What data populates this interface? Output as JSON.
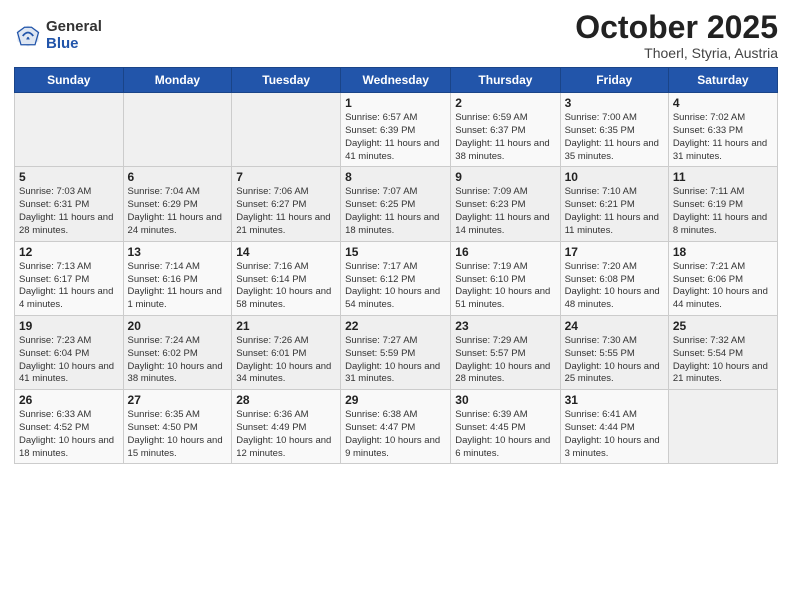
{
  "logo": {
    "general": "General",
    "blue": "Blue"
  },
  "title": {
    "month": "October 2025",
    "location": "Thoerl, Styria, Austria"
  },
  "days_of_week": [
    "Sunday",
    "Monday",
    "Tuesday",
    "Wednesday",
    "Thursday",
    "Friday",
    "Saturday"
  ],
  "weeks": [
    [
      {
        "day": "",
        "info": ""
      },
      {
        "day": "",
        "info": ""
      },
      {
        "day": "",
        "info": ""
      },
      {
        "day": "1",
        "info": "Sunrise: 6:57 AM\nSunset: 6:39 PM\nDaylight: 11 hours and 41 minutes."
      },
      {
        "day": "2",
        "info": "Sunrise: 6:59 AM\nSunset: 6:37 PM\nDaylight: 11 hours and 38 minutes."
      },
      {
        "day": "3",
        "info": "Sunrise: 7:00 AM\nSunset: 6:35 PM\nDaylight: 11 hours and 35 minutes."
      },
      {
        "day": "4",
        "info": "Sunrise: 7:02 AM\nSunset: 6:33 PM\nDaylight: 11 hours and 31 minutes."
      }
    ],
    [
      {
        "day": "5",
        "info": "Sunrise: 7:03 AM\nSunset: 6:31 PM\nDaylight: 11 hours and 28 minutes."
      },
      {
        "day": "6",
        "info": "Sunrise: 7:04 AM\nSunset: 6:29 PM\nDaylight: 11 hours and 24 minutes."
      },
      {
        "day": "7",
        "info": "Sunrise: 7:06 AM\nSunset: 6:27 PM\nDaylight: 11 hours and 21 minutes."
      },
      {
        "day": "8",
        "info": "Sunrise: 7:07 AM\nSunset: 6:25 PM\nDaylight: 11 hours and 18 minutes."
      },
      {
        "day": "9",
        "info": "Sunrise: 7:09 AM\nSunset: 6:23 PM\nDaylight: 11 hours and 14 minutes."
      },
      {
        "day": "10",
        "info": "Sunrise: 7:10 AM\nSunset: 6:21 PM\nDaylight: 11 hours and 11 minutes."
      },
      {
        "day": "11",
        "info": "Sunrise: 7:11 AM\nSunset: 6:19 PM\nDaylight: 11 hours and 8 minutes."
      }
    ],
    [
      {
        "day": "12",
        "info": "Sunrise: 7:13 AM\nSunset: 6:17 PM\nDaylight: 11 hours and 4 minutes."
      },
      {
        "day": "13",
        "info": "Sunrise: 7:14 AM\nSunset: 6:16 PM\nDaylight: 11 hours and 1 minute."
      },
      {
        "day": "14",
        "info": "Sunrise: 7:16 AM\nSunset: 6:14 PM\nDaylight: 10 hours and 58 minutes."
      },
      {
        "day": "15",
        "info": "Sunrise: 7:17 AM\nSunset: 6:12 PM\nDaylight: 10 hours and 54 minutes."
      },
      {
        "day": "16",
        "info": "Sunrise: 7:19 AM\nSunset: 6:10 PM\nDaylight: 10 hours and 51 minutes."
      },
      {
        "day": "17",
        "info": "Sunrise: 7:20 AM\nSunset: 6:08 PM\nDaylight: 10 hours and 48 minutes."
      },
      {
        "day": "18",
        "info": "Sunrise: 7:21 AM\nSunset: 6:06 PM\nDaylight: 10 hours and 44 minutes."
      }
    ],
    [
      {
        "day": "19",
        "info": "Sunrise: 7:23 AM\nSunset: 6:04 PM\nDaylight: 10 hours and 41 minutes."
      },
      {
        "day": "20",
        "info": "Sunrise: 7:24 AM\nSunset: 6:02 PM\nDaylight: 10 hours and 38 minutes."
      },
      {
        "day": "21",
        "info": "Sunrise: 7:26 AM\nSunset: 6:01 PM\nDaylight: 10 hours and 34 minutes."
      },
      {
        "day": "22",
        "info": "Sunrise: 7:27 AM\nSunset: 5:59 PM\nDaylight: 10 hours and 31 minutes."
      },
      {
        "day": "23",
        "info": "Sunrise: 7:29 AM\nSunset: 5:57 PM\nDaylight: 10 hours and 28 minutes."
      },
      {
        "day": "24",
        "info": "Sunrise: 7:30 AM\nSunset: 5:55 PM\nDaylight: 10 hours and 25 minutes."
      },
      {
        "day": "25",
        "info": "Sunrise: 7:32 AM\nSunset: 5:54 PM\nDaylight: 10 hours and 21 minutes."
      }
    ],
    [
      {
        "day": "26",
        "info": "Sunrise: 6:33 AM\nSunset: 4:52 PM\nDaylight: 10 hours and 18 minutes."
      },
      {
        "day": "27",
        "info": "Sunrise: 6:35 AM\nSunset: 4:50 PM\nDaylight: 10 hours and 15 minutes."
      },
      {
        "day": "28",
        "info": "Sunrise: 6:36 AM\nSunset: 4:49 PM\nDaylight: 10 hours and 12 minutes."
      },
      {
        "day": "29",
        "info": "Sunrise: 6:38 AM\nSunset: 4:47 PM\nDaylight: 10 hours and 9 minutes."
      },
      {
        "day": "30",
        "info": "Sunrise: 6:39 AM\nSunset: 4:45 PM\nDaylight: 10 hours and 6 minutes."
      },
      {
        "day": "31",
        "info": "Sunrise: 6:41 AM\nSunset: 4:44 PM\nDaylight: 10 hours and 3 minutes."
      },
      {
        "day": "",
        "info": ""
      }
    ]
  ]
}
